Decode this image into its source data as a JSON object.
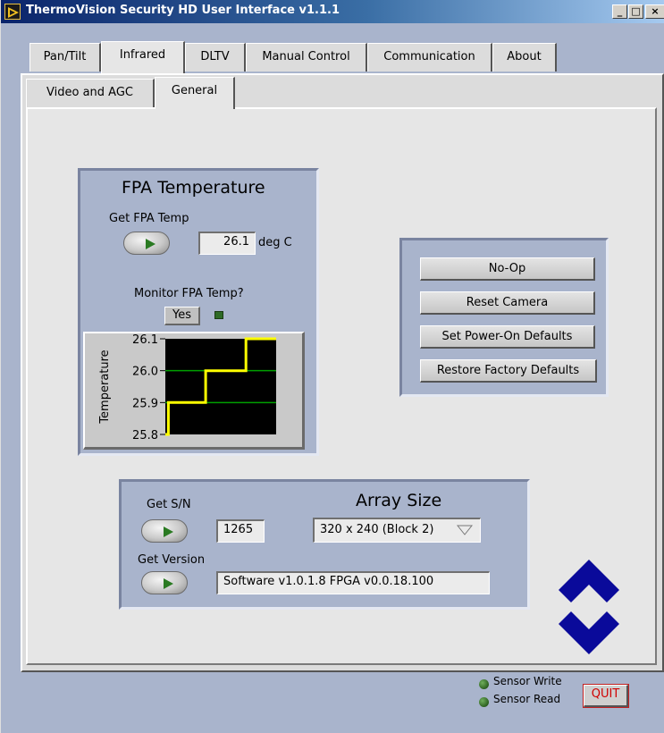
{
  "window": {
    "title": "ThermoVision Security HD User Interface v1.1.1",
    "minimize_glyph": "_",
    "maximize_glyph": "□",
    "close_glyph": "×"
  },
  "tabs": [
    {
      "label": "Pan/Tilt",
      "active": false
    },
    {
      "label": "Infrared",
      "active": true
    },
    {
      "label": "DLTV",
      "active": false
    },
    {
      "label": "Manual Control",
      "active": false
    },
    {
      "label": "Communication",
      "active": false
    },
    {
      "label": "About",
      "active": false
    }
  ],
  "subtabs": [
    {
      "label": "Video and AGC",
      "active": false
    },
    {
      "label": "General",
      "active": true
    }
  ],
  "fpa": {
    "title": "FPA Temperature",
    "get_label": "Get FPA Temp",
    "value": "26.1",
    "unit": "deg C",
    "monitor_label": "Monitor FPA Temp?",
    "monitor_value": "Yes"
  },
  "chart_data": {
    "type": "line",
    "ylabel": "Temperature",
    "xlabel": "",
    "ylim": [
      25.8,
      26.1
    ],
    "yticks": [
      "26.1",
      "26.0",
      "25.9",
      "25.8"
    ],
    "grid": true,
    "series": [
      {
        "x": [
          0,
          3,
          3,
          40,
          40,
          80,
          80,
          110,
          110
        ],
        "y": [
          25.8,
          25.8,
          25.9,
          25.9,
          26.0,
          26.0,
          26.1,
          26.1,
          26.1
        ]
      }
    ],
    "xlim": [
      0,
      110
    ],
    "colors": {
      "background": "#000000",
      "grid": "#00a000",
      "line": "#ffff00"
    }
  },
  "commands": {
    "noop": "No-Op",
    "reset": "Reset Camera",
    "set_defaults": "Set Power-On Defaults",
    "restore_defaults": "Restore Factory Defaults"
  },
  "info": {
    "get_sn_label": "Get S/N",
    "sn_value": "1265",
    "array_size_label": "Array Size",
    "array_size_value": "320 x 240 (Block 2)",
    "get_version_label": "Get Version",
    "version_value": "Software v1.0.1.8  FPGA v0.0.18.100"
  },
  "status": {
    "sensor_write": "Sensor Write",
    "sensor_read": "Sensor Read",
    "quit": "QUIT"
  },
  "colors": {
    "frame": "#a9b4cc",
    "panel": "#e6e6e6",
    "logo": "#0a0a9a",
    "quit_text": "#d00000"
  }
}
